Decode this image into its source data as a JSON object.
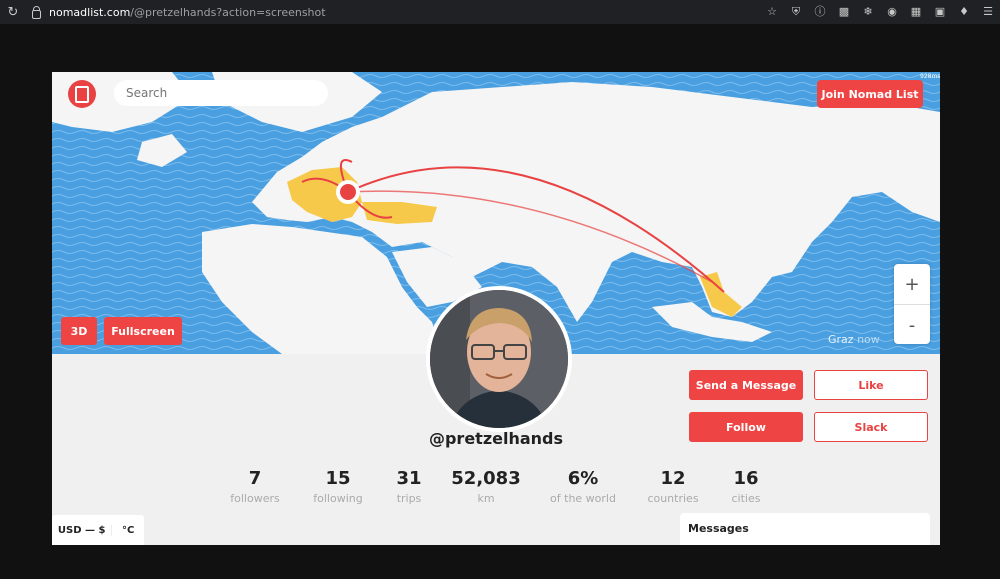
{
  "browser": {
    "url_host": "nomadlist.com",
    "url_path": "/@pretzelhands?action=screenshot"
  },
  "map": {
    "search_placeholder": "Search",
    "join_label": "Join Nomad List",
    "btn_3d": "3D",
    "btn_fullscreen": "Fullscreen",
    "zoom_in": "+",
    "zoom_out": "-",
    "current_city": "Graz",
    "current_suffix": "now",
    "scale_text": "928ms",
    "colors": {
      "water": "#4a9fe0",
      "land": "#f5f5f5",
      "visited": "#f6c94a",
      "route": "#e84242"
    }
  },
  "profile": {
    "username": "@pretzelhands",
    "actions": {
      "send_message": "Send a Message",
      "like": "Like",
      "follow": "Follow",
      "slack": "Slack"
    }
  },
  "stats": [
    {
      "value": "7",
      "label": "followers"
    },
    {
      "value": "15",
      "label": "following"
    },
    {
      "value": "31",
      "label": "trips"
    },
    {
      "value": "52,083",
      "label": "km"
    },
    {
      "value": "6%",
      "label": "of the world"
    },
    {
      "value": "12",
      "label": "countries"
    },
    {
      "value": "16",
      "label": "cities"
    }
  ],
  "footer": {
    "currency": "USD — $",
    "temp_unit": "°C",
    "messages_title": "Messages"
  },
  "accent": "#ef4444"
}
